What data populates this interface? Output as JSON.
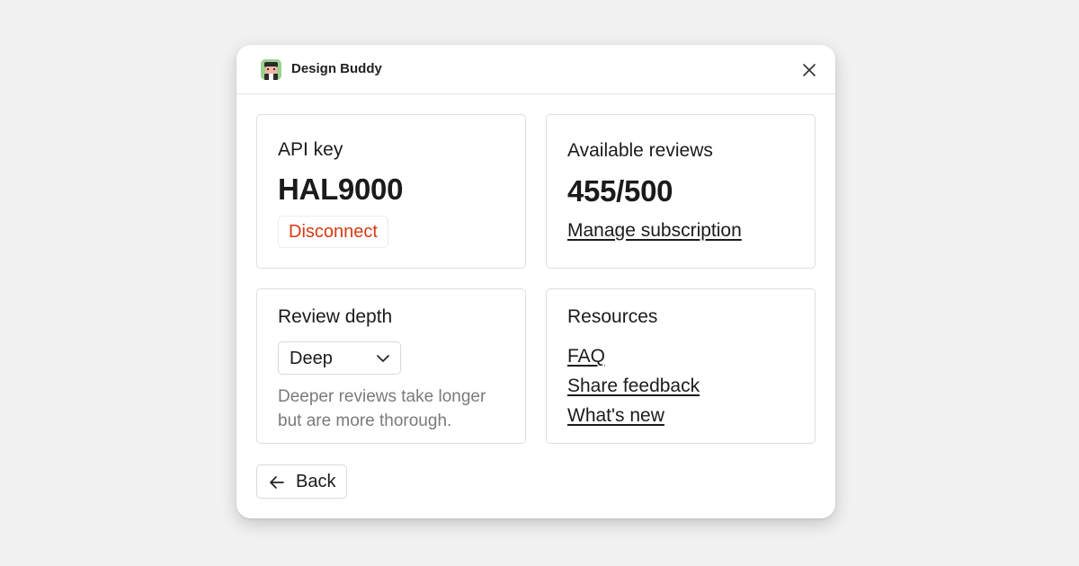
{
  "app": {
    "name": "Design Buddy",
    "icon": "avatar-app-icon"
  },
  "api_key": {
    "label": "API key",
    "value": "HAL9000",
    "disconnect_label": "Disconnect"
  },
  "reviews": {
    "label": "Available reviews",
    "value": "455/500",
    "manage_link": "Manage subscription"
  },
  "depth": {
    "label": "Review depth",
    "selected": "Deep",
    "helper": "Deeper reviews take longer but are more thorough."
  },
  "resources": {
    "label": "Resources",
    "links": [
      "FAQ",
      "Share feedback",
      "What's new"
    ]
  },
  "footer": {
    "back_label": "Back"
  },
  "colors": {
    "danger": "#d93a12",
    "background": "#f1f1f1",
    "panel": "#ffffff"
  }
}
